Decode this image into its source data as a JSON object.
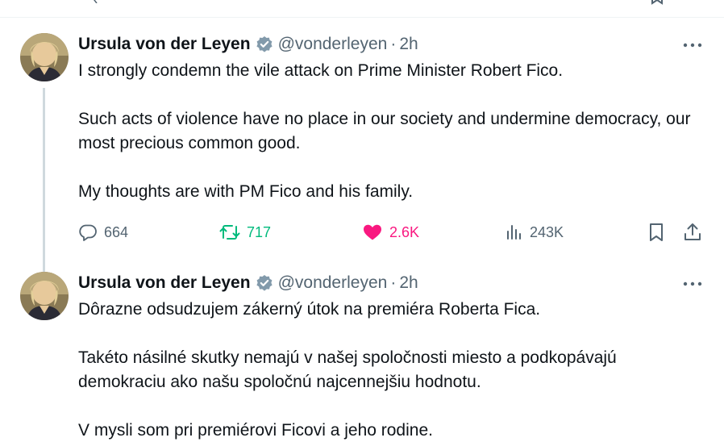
{
  "tweets": [
    {
      "author_name": "Ursula von der Leyen",
      "handle": "@vonderleyen",
      "separator": "·",
      "time": "2h",
      "paragraphs": [
        "I strongly condemn the vile attack on Prime Minister Robert Fico.",
        "Such acts of violence have no place in our society and undermine democracy, our most precious common good.",
        "My thoughts are with PM Fico and his family."
      ],
      "stats": {
        "replies": "664",
        "reposts": "717",
        "likes": "2.6K",
        "views": "243K"
      }
    },
    {
      "author_name": "Ursula von der Leyen",
      "handle": "@vonderleyen",
      "separator": "·",
      "time": "2h",
      "paragraphs": [
        "Dôrazne odsudzujem zákerný útok na premiéra Roberta Fica.",
        "Takéto násilné skutky nemajú v našej spoločnosti miesto a podkopávajú demokraciu ako našu spoločnú najcennejšiu hodnotu.",
        "V mysli som pri premiérovi Ficovi a jeho rodine."
      ]
    }
  ],
  "colors": {
    "text": "#0f1419",
    "secondary": "#536471",
    "verified_blue": "#1d9bf0",
    "repost_green": "#00ba7c",
    "like_pink": "#f91880",
    "thread_line": "#cfd9de"
  },
  "icons": {
    "reply": "speech-bubble-icon",
    "repost": "repost-arrows-icon",
    "like": "heart-filled-icon",
    "views": "bar-chart-icon",
    "bookmark": "bookmark-icon",
    "share": "share-upload-icon",
    "more": "ellipsis-icon",
    "verified": "verified-badge-icon"
  }
}
